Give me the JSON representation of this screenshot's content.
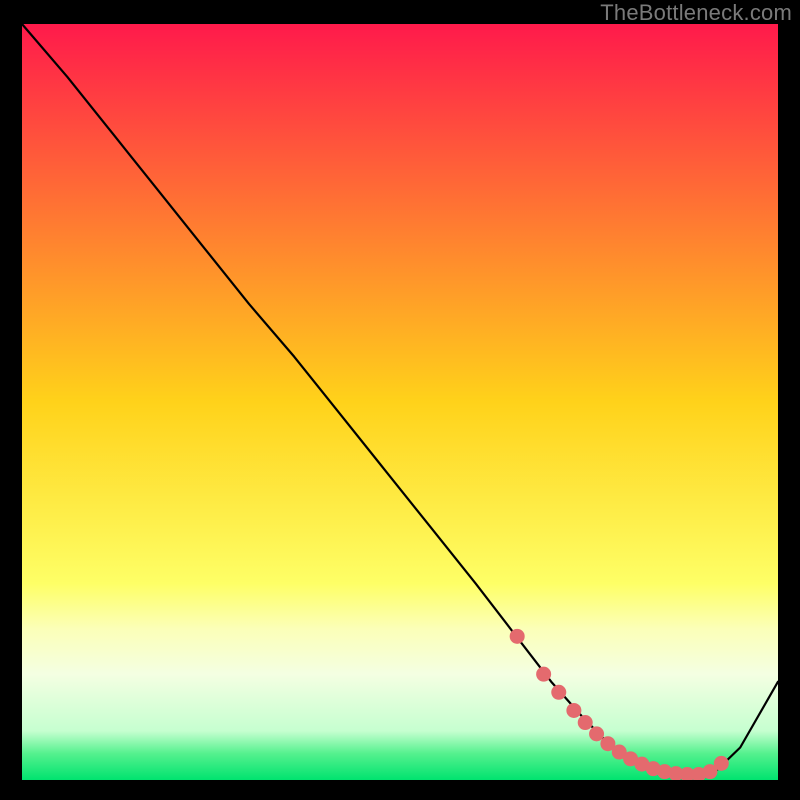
{
  "watermark": "TheBottleneck.com",
  "colors": {
    "background": "#000000",
    "curve": "#000000",
    "marker_fill": "#e46a6e",
    "marker_stroke": "#d95a5e",
    "gradient_stops": [
      {
        "offset": 0.0,
        "color": "#ff1a4b"
      },
      {
        "offset": 0.5,
        "color": "#ffd21a"
      },
      {
        "offset": 0.74,
        "color": "#feff66"
      },
      {
        "offset": 0.8,
        "color": "#fbffb8"
      },
      {
        "offset": 0.86,
        "color": "#f4ffe2"
      },
      {
        "offset": 0.935,
        "color": "#c6ffd0"
      },
      {
        "offset": 0.965,
        "color": "#55f18e"
      },
      {
        "offset": 1.0,
        "color": "#00e36f"
      }
    ]
  },
  "chart_data": {
    "type": "line",
    "title": "",
    "xlabel": "",
    "ylabel": "",
    "xlim": [
      0,
      100
    ],
    "ylim": [
      0,
      100
    ],
    "series": [
      {
        "name": "curve",
        "x": [
          0,
          6,
          12,
          18,
          24,
          30,
          36,
          42,
          48,
          54,
          60,
          65,
          70,
          74,
          77,
          80,
          83,
          86,
          89,
          92,
          95,
          100
        ],
        "y": [
          100,
          93,
          85.5,
          78,
          70.5,
          63,
          56,
          48.5,
          41,
          33.5,
          26,
          19.5,
          13,
          8.5,
          5.4,
          3.2,
          1.7,
          0.9,
          0.7,
          1.4,
          4.3,
          13
        ]
      }
    ],
    "markers": {
      "name": "highlight-dots",
      "x": [
        65.5,
        69,
        71,
        73,
        74.5,
        76,
        77.5,
        79,
        80.5,
        82,
        83.5,
        85,
        86.5,
        88,
        89.5,
        91,
        92.5
      ],
      "y": [
        19,
        14,
        11.6,
        9.2,
        7.6,
        6.1,
        4.8,
        3.7,
        2.8,
        2.1,
        1.5,
        1.1,
        0.85,
        0.72,
        0.73,
        1.1,
        2.2
      ]
    }
  }
}
